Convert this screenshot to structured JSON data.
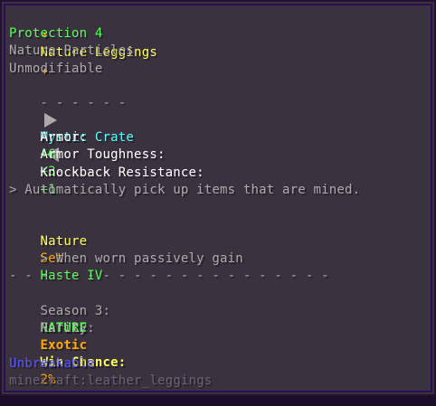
{
  "item": {
    "star_left": "✦",
    "name": "Nature Leggings",
    "star_right": "✦",
    "enchant": "Protection 4",
    "particles": "Nature Particles",
    "unmodifiable": "Unmodifiable",
    "crate_dashes_left": "- - - - - -",
    "crate_name": "Mystic Crate",
    "crate_dashes_right": "- - - - - -"
  },
  "stats": [
    {
      "label": "Armor:",
      "value": "+6"
    },
    {
      "label": "Armor Toughness:",
      "value": "+3"
    },
    {
      "label": "Knockback Resistance:",
      "value": "+1"
    }
  ],
  "ability": "> Automatically pick up items that are mined.",
  "set": {
    "name": "Nature",
    "suffix": "Set",
    "bonus_prefix": "> When worn passively gain",
    "bonus_effect": "Haste IV"
  },
  "divider": "- - - - - - - - - - - - - - - - - - - - -",
  "season": {
    "label": "Season 3:",
    "value": "NATURE"
  },
  "rarity": {
    "label": "Rarity:",
    "value": "Exotic"
  },
  "win_chance": {
    "label": "Win Chance:",
    "value": "2%"
  },
  "unbreakable": "Unbreakable",
  "item_id": "minecraft:leather_leggings",
  "colors": {
    "background": "#3b3240",
    "border": "#2a0f57",
    "green": "#55ff55",
    "gray": "#aaaaaa",
    "gold": "#ffaa00",
    "yellow": "#ffff55",
    "aqua": "#55ffff",
    "blue": "#5555ff"
  }
}
